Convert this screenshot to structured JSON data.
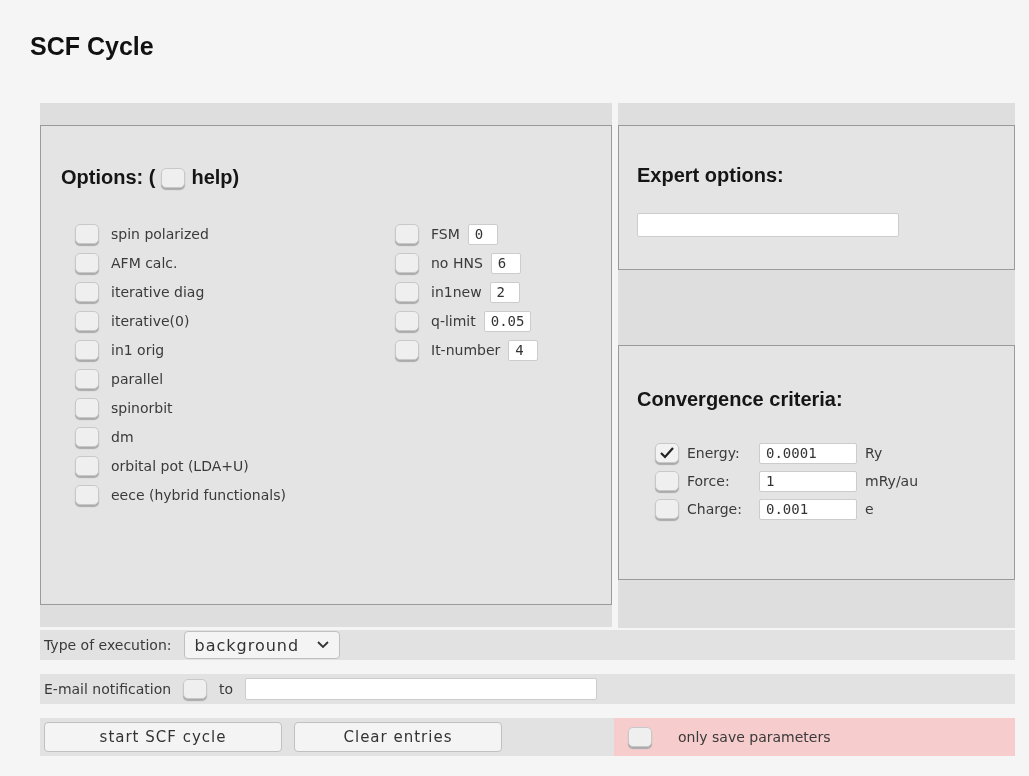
{
  "page_title": "SCF Cycle",
  "options": {
    "title": "Options: (",
    "help": {
      "label": "help)",
      "checked": false
    },
    "left_items": [
      {
        "label": "spin polarized",
        "checked": false
      },
      {
        "label": "AFM calc.",
        "checked": false
      },
      {
        "label": "iterative diag",
        "checked": false
      },
      {
        "label": "iterative(0)",
        "checked": false
      },
      {
        "label": "in1 orig",
        "checked": false
      },
      {
        "label": "parallel",
        "checked": false
      },
      {
        "label": "spinorbit",
        "checked": false
      },
      {
        "label": "dm",
        "checked": false
      },
      {
        "label": "orbital pot (LDA+U)",
        "checked": false
      },
      {
        "label": "eece (hybrid functionals)",
        "checked": false
      }
    ],
    "right_items": [
      {
        "label": "FSM",
        "checked": false,
        "value": "0"
      },
      {
        "label": "no HNS",
        "checked": false,
        "value": "6"
      },
      {
        "label": "in1new",
        "checked": false,
        "value": "2"
      },
      {
        "label": "q-limit",
        "checked": false,
        "value": "0.05"
      },
      {
        "label": "It-number",
        "checked": false,
        "value": "4"
      }
    ]
  },
  "expert": {
    "title": "Expert options:"
  },
  "convergence": {
    "title": "Convergence criteria:",
    "items": [
      {
        "label": "Energy:",
        "checked": true,
        "value": "0.0001",
        "unit": "Ry"
      },
      {
        "label": "Force:",
        "checked": false,
        "value": "1",
        "unit": "mRy/au"
      },
      {
        "label": "Charge:",
        "checked": false,
        "value": "0.001",
        "unit": "e"
      }
    ]
  },
  "execution": {
    "label": "Type of execution:",
    "value": "background"
  },
  "email": {
    "label": "E-mail notification",
    "checked": false,
    "to": "to"
  },
  "buttons": [
    "start SCF cycle",
    "Clear entries"
  ],
  "save_only": {
    "label": "only save parameters",
    "checked": false
  }
}
